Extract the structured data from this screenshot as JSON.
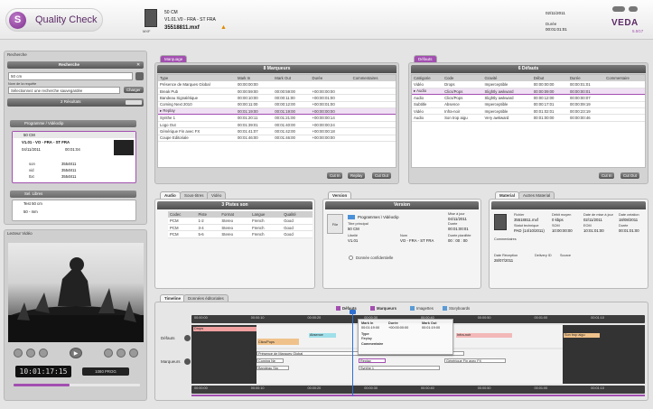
{
  "app": {
    "title": "Quality Check",
    "brand": "VEDA",
    "brand_sub": "5.5G7",
    "accent_color": "#a24fb0"
  },
  "header": {
    "media_line1": "50 CM",
    "media_line2": "V1.01.V0 - FRA - ST FRA",
    "media_file": "35518811.mxf",
    "date_value": "02/11/2011",
    "duration_label": "Durée",
    "duration_value": "00:01:01:01"
  },
  "search": {
    "title": "Recherche",
    "header": "Recherche",
    "query": "50 cm",
    "saved_label": "Nom de la requête",
    "saved_placeholder": "Sélectionnez une recherche sauvegardée",
    "saved_button": "Charger",
    "results_count": "2 Résultats",
    "group_label": "Programme / Vidéoclip",
    "result1_title": "50 CM",
    "result1_version": "V1.01 - VO - FRA - ST FRA",
    "result1_date": "04/11/2011",
    "result1_duration": "00:01:04",
    "result1_tags": [
      "son",
      "vid",
      "ttxt"
    ],
    "result1_ids": [
      "3554811",
      "3554811",
      "3554811"
    ],
    "group2_label": "Sel. Libres",
    "result2_title": "Test 50 cm",
    "result2_sub": "50 - mm"
  },
  "player": {
    "title": "Lecteur Vidéo",
    "timecode": "10:01:17:15",
    "mode": "1080 PROG"
  },
  "markers": {
    "tab": "Marquage",
    "header": "8 Marqueurs",
    "columns": [
      "Type",
      "Mark In",
      "Mark Out",
      "Durée",
      "Commentaires"
    ],
    "rows": [
      [
        "Présence de Marques Global",
        "00:00:00:00",
        "",
        "",
        ""
      ],
      [
        "Break Pub",
        "00:00:59:00",
        "00:00:59:00",
        "+00:00:00:00",
        ""
      ],
      [
        "Bandeau Signalétique",
        "00:00:10:00",
        "00:00:11:00",
        "+00:00:01:00",
        ""
      ],
      [
        "Coming Next 2010",
        "00:00:11:00",
        "00:00:12:00",
        "+00:00:01:00",
        ""
      ],
      [
        "Replay",
        "00:01:19:00",
        "00:01:19:00",
        "+00:00:00:00",
        ""
      ],
      [
        "Synthe 1",
        "00:01:20:11",
        "00:01:21:00",
        "+00:00:00:14",
        ""
      ],
      [
        "Logo Out",
        "00:01:39:01",
        "00:01:40:00",
        "+00:00:00:24",
        ""
      ],
      [
        "Générique Fin avec FX",
        "00:01:41:07",
        "00:01:42:00",
        "+00:00:00:18",
        ""
      ],
      [
        "Coupe Editoriale",
        "00:01:46:00",
        "00:01:46:00",
        "+00:00:00:00",
        ""
      ]
    ],
    "selected_row": 4,
    "buttons": [
      "Cut In",
      "Replay",
      "Cut Out"
    ]
  },
  "defects": {
    "tab": "Défauts",
    "header": "6 Défauts",
    "columns": [
      "Catégorie",
      "Code",
      "Gravité",
      "Début",
      "Durée",
      "Commentaire"
    ],
    "rows": [
      [
        "Vidéo",
        "Drops",
        "Imperceptible",
        "00:00:00:00",
        "00:00:01:01",
        ""
      ],
      [
        "Audio",
        "Clics/Pops",
        "Slightly awkward",
        "00:00:09:00",
        "00:00:00:01",
        ""
      ],
      [
        "Audio",
        "Clics/Pops",
        "Slightly awkward",
        "00:00:12:00",
        "00:00:00:07",
        ""
      ],
      [
        "Subtitle",
        "Absence",
        "Imperceptible",
        "00:00:17:01",
        "00:00:09:19",
        ""
      ],
      [
        "Vidéo",
        "Infra-noir",
        "Imperceptible",
        "00:01:02:01",
        "00:00:23:19",
        ""
      ],
      [
        "Audio",
        "Son trop aigu",
        "Very awkward",
        "00:01:00:00",
        "00:00:00:46",
        ""
      ]
    ],
    "selected_row": 1,
    "buttons": [
      "Cut In",
      "Cut Out"
    ]
  },
  "audio": {
    "tabs": [
      "Audio",
      "Sous-titres",
      "Vidéo"
    ],
    "header": "3 Pistes son",
    "columns": [
      "Codec",
      "Piste",
      "Format",
      "Langue",
      "Qualité"
    ],
    "rows": [
      [
        "PCM",
        "1-2",
        "Stereo",
        "French",
        "Good"
      ],
      [
        "PCM",
        "3-4",
        "Stereo",
        "French",
        "Good"
      ],
      [
        "PCM",
        "5-6",
        "Stereo",
        "French",
        "Good"
      ]
    ]
  },
  "version": {
    "tab": "Version",
    "header": "Version",
    "breadcrumb": "Programmes \\ Vidéoclip",
    "title_label": "Titre principal",
    "title_value": "50 CM",
    "label_label": "Libellé",
    "label_value": "V1.01",
    "name_label": "Nom",
    "name_value": "VO - FRA - ST FRA",
    "date_label": "Mise à jour",
    "date_value": "04/11/2011",
    "dur_label": "Durée",
    "dur_value": "00:01:00:01",
    "dur2_label": "Durée planifiée",
    "dur2_value": "00 : 00 : 00",
    "confidential": "Donnée confidentielle"
  },
  "material": {
    "tabs": [
      "Material",
      "Autres Material"
    ],
    "file_label": "Fichier",
    "file_value": "35518811.mxf",
    "size_label": "Débit moyen",
    "size_value": "0 kbps",
    "maj_label": "Date de mise à jour",
    "maj_value": "02/11/2011",
    "create_label": "Date création",
    "create_value": "18/08/2011",
    "tech_label": "Statut technique",
    "tech_value": "PAD (14/10/2011)",
    "som_label": "SOM",
    "som_value": "10:00:00:00",
    "eom_label": "EOM",
    "eom_value": "10:01:01:00",
    "dur_label": "Durée",
    "dur_value": "00:01:01:00",
    "comments_label": "Commentaires",
    "recv_label": "Date Réception",
    "recv_value": "28/07/2011",
    "delivery_label": "Delivery ID",
    "source_label": "Source"
  },
  "timeline": {
    "tabs": [
      "Timeline",
      "Données éditoriales"
    ],
    "legend": [
      "Défauts",
      "Marqueurs",
      "Imagettes",
      "Storyboards"
    ],
    "ticks": [
      "00:00:00",
      "00:00:10",
      "00:00:20",
      "00:00:30",
      "00:00:40",
      "00:00:50",
      "00:01:00",
      "00:01:10"
    ],
    "track_labels": [
      "Défauts",
      "Marqueurs"
    ],
    "defect_labels": [
      "Drops",
      "Absence",
      "Clics/Pops",
      "Infra-noir",
      "Son trop aigu"
    ],
    "marker_labels": [
      "Présence de Marques Global",
      "Coming Ne",
      "Bandeau Sig",
      "Replay",
      "Synthe 1",
      "Générique Fin avec FX"
    ],
    "tooltip": {
      "markin_label": "Mark In",
      "markin": "00:01:19:00",
      "duree_label": "Durée",
      "duree": "+00:00:00:00",
      "markout_label": "Mark Out",
      "markout": "00:01:19:00",
      "type_label": "Type",
      "type": "Replay",
      "comment_label": "Commentaire"
    }
  }
}
